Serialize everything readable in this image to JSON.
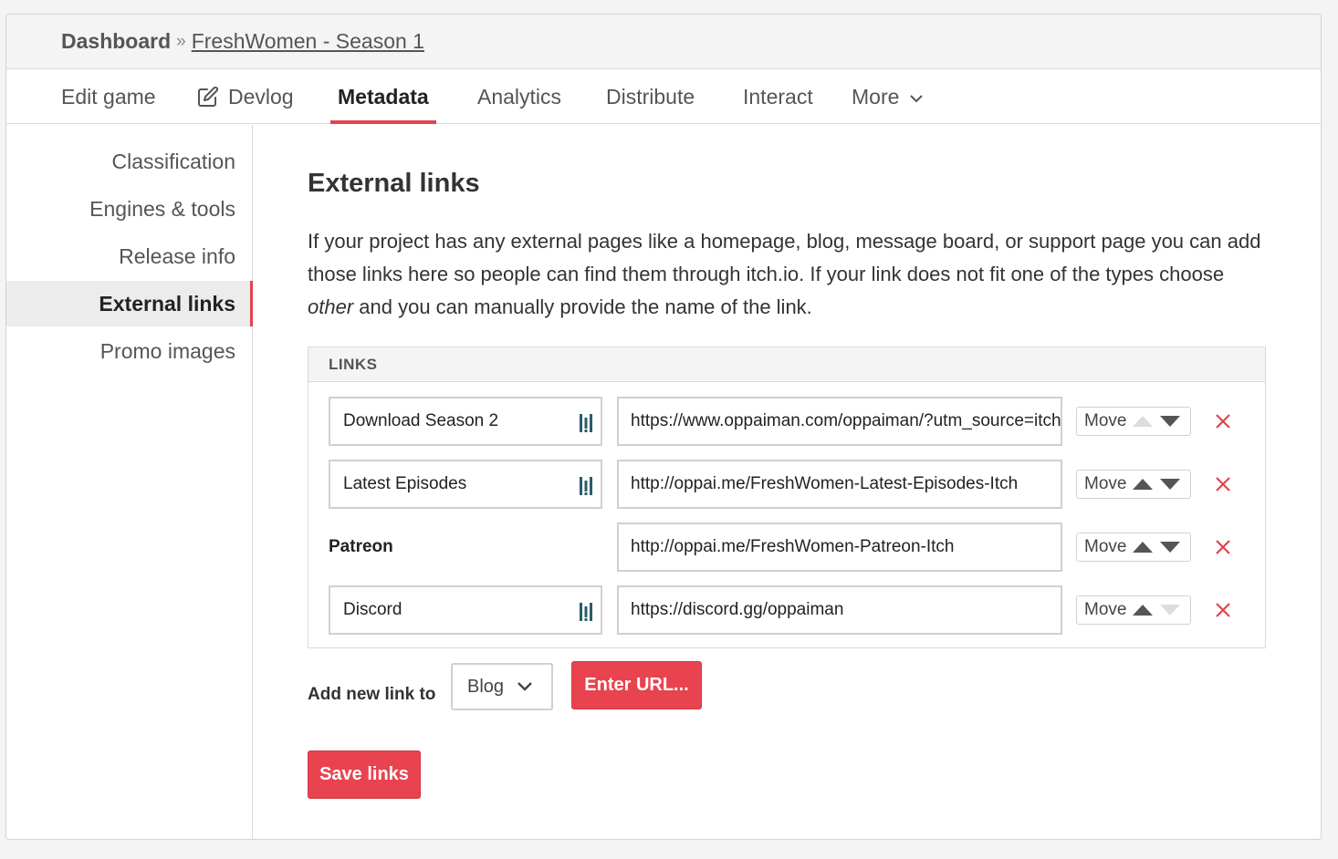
{
  "breadcrumb": {
    "dashboard": "Dashboard",
    "separator": "»",
    "game": "FreshWomen - Season 1"
  },
  "tabs": {
    "edit_game": "Edit game",
    "devlog": "Devlog",
    "metadata": "Metadata",
    "analytics": "Analytics",
    "distribute": "Distribute",
    "interact": "Interact",
    "more": "More"
  },
  "sidebar": {
    "classification": "Classification",
    "engines_tools": "Engines & tools",
    "release_info": "Release info",
    "external_links": "External links",
    "promo_images": "Promo images"
  },
  "main": {
    "title": "External links",
    "intro_before": "If your project has any external pages like a homepage, blog, message board, or support page you can add those links here so people can find them through itch.io. If your link does not fit one of the types choose ",
    "intro_em": "other",
    "intro_after": " and you can manually provide the name of the link.",
    "links_header": "LINKS",
    "move_label": "Move",
    "links": [
      {
        "name": "Download Season 2",
        "url": "https://www.oppaiman.com/oppaiman/?utm_source=itch"
      },
      {
        "name": "Latest Episodes",
        "url": "http://oppai.me/FreshWomen-Latest-Episodes-Itch"
      },
      {
        "name": "Patreon",
        "url": "http://oppai.me/FreshWomen-Patreon-Itch"
      },
      {
        "name": "Discord",
        "url": "https://discord.gg/oppaiman"
      }
    ],
    "add_label": "Add new link to",
    "select_value": "Blog",
    "enter_url": "Enter URL...",
    "save": "Save links"
  },
  "colors": {
    "accent": "#e8434f",
    "remove": "#e0444c",
    "arrow_active": "#555555",
    "arrow_disabled": "#dddddd"
  }
}
